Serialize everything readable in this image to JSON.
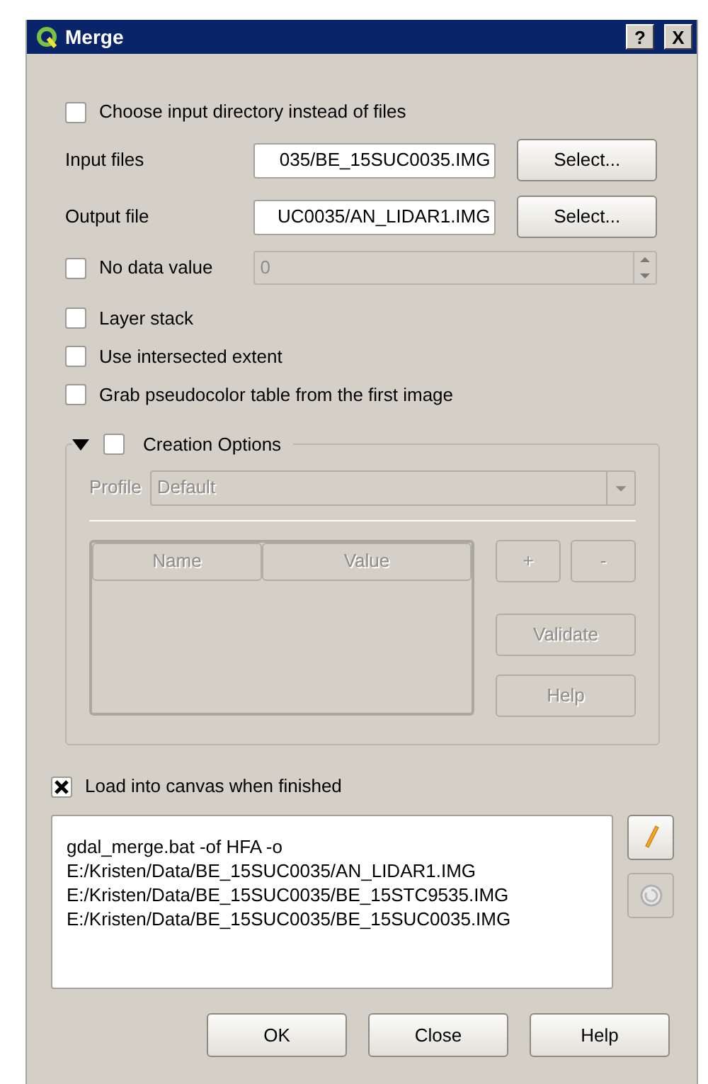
{
  "window": {
    "title": "Merge",
    "buttons": [
      "?",
      "X"
    ]
  },
  "input_directory": {
    "label": "Choose input directory instead of files",
    "checked": false
  },
  "files": [
    {
      "label": "Input files",
      "value": "035/BE_15SUC0035.IMG",
      "button": "Select..."
    },
    {
      "label": "Output file",
      "value": "UC0035/AN_LIDAR1.IMG",
      "button": "Select..."
    }
  ],
  "nodata": {
    "label": "No data value",
    "checked": false,
    "value": "0"
  },
  "options": [
    {
      "label": "Layer stack",
      "checked": false
    },
    {
      "label": "Use intersected extent",
      "checked": false
    },
    {
      "label": "Grab pseudocolor table from the first image",
      "checked": false
    }
  ],
  "creation_options": {
    "label": "Creation Options",
    "checked": false,
    "expanded": true,
    "profile_label": "Profile",
    "profile": "Default",
    "columns": [
      "Name",
      "Value"
    ],
    "row_buttons": [
      "+",
      "-"
    ],
    "side_buttons": [
      "Validate",
      "Help"
    ]
  },
  "load": {
    "label": "Load into canvas when finished",
    "checked": true
  },
  "command_lines": [
    "gdal_merge.bat -of HFA -o",
    "E:/Kristen/Data/BE_15SUC0035/AN_LIDAR1.IMG",
    "E:/Kristen/Data/BE_15SUC0035/BE_15STC9535.IMG",
    "E:/Kristen/Data/BE_15SUC0035/BE_15SUC0035.IMG"
  ],
  "buttons": [
    "OK",
    "Close",
    "Help"
  ]
}
